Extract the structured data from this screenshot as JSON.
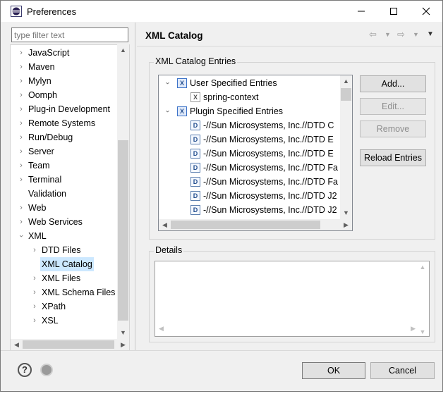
{
  "window": {
    "title": "Preferences"
  },
  "filter": {
    "placeholder": "type filter text"
  },
  "tree": [
    {
      "label": "JavaScript",
      "expander": "collapsed",
      "level": 0
    },
    {
      "label": "Maven",
      "expander": "collapsed",
      "level": 0
    },
    {
      "label": "Mylyn",
      "expander": "collapsed",
      "level": 0
    },
    {
      "label": "Oomph",
      "expander": "collapsed",
      "level": 0
    },
    {
      "label": "Plug-in Development",
      "expander": "collapsed",
      "level": 0
    },
    {
      "label": "Remote Systems",
      "expander": "collapsed",
      "level": 0
    },
    {
      "label": "Run/Debug",
      "expander": "collapsed",
      "level": 0
    },
    {
      "label": "Server",
      "expander": "collapsed",
      "level": 0
    },
    {
      "label": "Team",
      "expander": "collapsed",
      "level": 0
    },
    {
      "label": "Terminal",
      "expander": "collapsed",
      "level": 0
    },
    {
      "label": "Validation",
      "expander": "none",
      "level": 0
    },
    {
      "label": "Web",
      "expander": "collapsed",
      "level": 0
    },
    {
      "label": "Web Services",
      "expander": "collapsed",
      "level": 0
    },
    {
      "label": "XML",
      "expander": "expanded",
      "level": 0
    },
    {
      "label": "DTD Files",
      "expander": "collapsed",
      "level": 1
    },
    {
      "label": "XML Catalog",
      "expander": "none",
      "level": 1,
      "selected": true
    },
    {
      "label": "XML Files",
      "expander": "collapsed",
      "level": 1
    },
    {
      "label": "XML Schema Files",
      "expander": "collapsed",
      "level": 1
    },
    {
      "label": "XPath",
      "expander": "collapsed",
      "level": 1
    },
    {
      "label": "XSL",
      "expander": "collapsed",
      "level": 1
    }
  ],
  "page": {
    "title": "XML Catalog"
  },
  "entries_group": {
    "label": "XML Catalog Entries"
  },
  "entries": [
    {
      "label": "User Specified Entries",
      "icon": "catalog-icon",
      "level": 0,
      "expanded": true
    },
    {
      "label": "spring-context",
      "icon": "xml-file-icon",
      "level": 1
    },
    {
      "label": "Plugin Specified Entries",
      "icon": "catalog-icon",
      "level": 0,
      "expanded": true
    },
    {
      "label": "-//Sun Microsystems, Inc.//DTD C",
      "icon": "dtd-icon",
      "level": 1
    },
    {
      "label": "-//Sun Microsystems, Inc.//DTD E",
      "icon": "dtd-icon",
      "level": 1
    },
    {
      "label": "-//Sun Microsystems, Inc.//DTD E",
      "icon": "dtd-icon",
      "level": 1
    },
    {
      "label": "-//Sun Microsystems, Inc.//DTD Fa",
      "icon": "dtd-icon",
      "level": 1
    },
    {
      "label": "-//Sun Microsystems, Inc.//DTD Fa",
      "icon": "dtd-icon",
      "level": 1
    },
    {
      "label": "-//Sun Microsystems, Inc.//DTD J2",
      "icon": "dtd-icon",
      "level": 1
    },
    {
      "label": "-//Sun Microsystems, Inc.//DTD J2",
      "icon": "dtd-icon",
      "level": 1
    }
  ],
  "buttons": {
    "add": "Add...",
    "edit": "Edit...",
    "remove": "Remove",
    "reload": "Reload Entries",
    "ok": "OK",
    "cancel": "Cancel"
  },
  "details_group": {
    "label": "Details"
  },
  "colors": {
    "selection": "#cce8ff",
    "window_bg": "#f0f0f0",
    "button_bg": "#e1e1e1"
  }
}
